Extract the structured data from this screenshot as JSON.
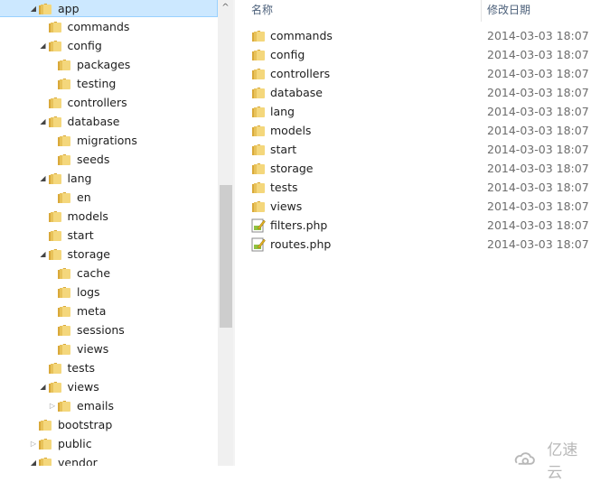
{
  "tree": [
    {
      "label": "app",
      "level": 0,
      "expander": "expanded",
      "selected": true
    },
    {
      "label": "commands",
      "level": 1,
      "expander": "none"
    },
    {
      "label": "config",
      "level": 1,
      "expander": "expanded"
    },
    {
      "label": "packages",
      "level": 2,
      "expander": "none"
    },
    {
      "label": "testing",
      "level": 2,
      "expander": "none"
    },
    {
      "label": "controllers",
      "level": 1,
      "expander": "none"
    },
    {
      "label": "database",
      "level": 1,
      "expander": "expanded"
    },
    {
      "label": "migrations",
      "level": 2,
      "expander": "none"
    },
    {
      "label": "seeds",
      "level": 2,
      "expander": "none"
    },
    {
      "label": "lang",
      "level": 1,
      "expander": "expanded"
    },
    {
      "label": "en",
      "level": 2,
      "expander": "none"
    },
    {
      "label": "models",
      "level": 1,
      "expander": "none"
    },
    {
      "label": "start",
      "level": 1,
      "expander": "none"
    },
    {
      "label": "storage",
      "level": 1,
      "expander": "expanded"
    },
    {
      "label": "cache",
      "level": 2,
      "expander": "none"
    },
    {
      "label": "logs",
      "level": 2,
      "expander": "none"
    },
    {
      "label": "meta",
      "level": 2,
      "expander": "none"
    },
    {
      "label": "sessions",
      "level": 2,
      "expander": "none"
    },
    {
      "label": "views",
      "level": 2,
      "expander": "none"
    },
    {
      "label": "tests",
      "level": 1,
      "expander": "none"
    },
    {
      "label": "views",
      "level": 1,
      "expander": "expanded"
    },
    {
      "label": "emails",
      "level": 2,
      "expander": "collapsed"
    },
    {
      "label": "bootstrap",
      "level": 0,
      "expander": "none"
    },
    {
      "label": "public",
      "level": 0,
      "expander": "collapsed"
    },
    {
      "label": "vendor",
      "level": 0,
      "expander": "expanded"
    }
  ],
  "list": {
    "headers": {
      "name": "名称",
      "modified": "修改日期"
    },
    "items": [
      {
        "name": "commands",
        "date": "2014-03-03 18:07",
        "icon": "folder-icon"
      },
      {
        "name": "config",
        "date": "2014-03-03 18:07",
        "icon": "folder-icon"
      },
      {
        "name": "controllers",
        "date": "2014-03-03 18:07",
        "icon": "folder-icon"
      },
      {
        "name": "database",
        "date": "2014-03-03 18:07",
        "icon": "folder-icon"
      },
      {
        "name": "lang",
        "date": "2014-03-03 18:07",
        "icon": "folder-icon"
      },
      {
        "name": "models",
        "date": "2014-03-03 18:07",
        "icon": "folder-icon"
      },
      {
        "name": "start",
        "date": "2014-03-03 18:07",
        "icon": "folder-icon"
      },
      {
        "name": "storage",
        "date": "2014-03-03 18:07",
        "icon": "folder-icon"
      },
      {
        "name": "tests",
        "date": "2014-03-03 18:07",
        "icon": "folder-icon"
      },
      {
        "name": "views",
        "date": "2014-03-03 18:07",
        "icon": "folder-icon"
      },
      {
        "name": "filters.php",
        "date": "2014-03-03 18:07",
        "icon": "php-file-icon"
      },
      {
        "name": "routes.php",
        "date": "2014-03-03 18:07",
        "icon": "php-file-icon"
      }
    ]
  },
  "watermark": "亿速云",
  "colors": {
    "selection": "#cce8ff",
    "folder": "#e8c25a"
  }
}
